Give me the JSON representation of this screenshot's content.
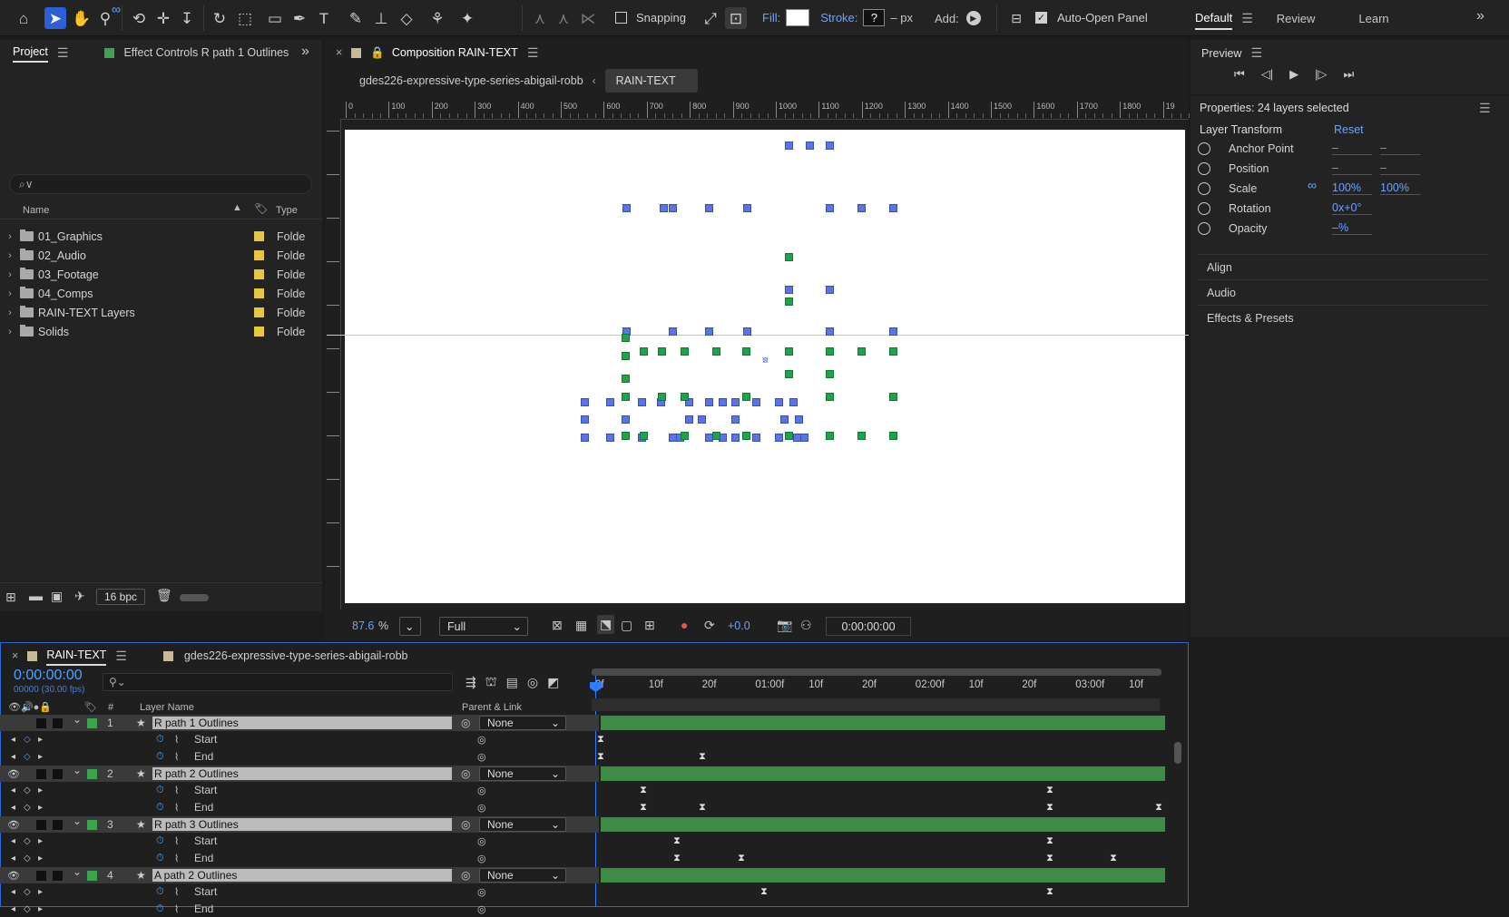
{
  "toolbar": {
    "snapping_label": "Snapping",
    "fill_label": "Fill:",
    "stroke_label": "Stroke:",
    "stroke_value": "?",
    "stroke_unit": "– px",
    "add_label": "Add:",
    "auto_open_label": "Auto-Open Panel",
    "workspaces": [
      "Default",
      "Review",
      "Learn"
    ]
  },
  "project_panel": {
    "tab_project": "Project",
    "tab_effect_controls": "Effect Controls R path 1 Outlines",
    "search_placeholder": "⌕∨",
    "col_name": "Name",
    "col_type": "Type",
    "items": [
      {
        "name": "01_Graphics",
        "type": "Folde"
      },
      {
        "name": "02_Audio",
        "type": "Folde"
      },
      {
        "name": "03_Footage",
        "type": "Folde"
      },
      {
        "name": "04_Comps",
        "type": "Folde"
      },
      {
        "name": "RAIN-TEXT Layers",
        "type": "Folde"
      },
      {
        "name": "Solids",
        "type": "Folde"
      }
    ],
    "bpc": "16 bpc"
  },
  "composition": {
    "tab_title": "Composition RAIN-TEXT",
    "breadcrumb_parent": "gdes226-expressive-type-series-abigail-robb",
    "breadcrumb_current": "RAIN-TEXT",
    "ruler_labels": [
      "0",
      "100",
      "200",
      "300",
      "400",
      "500",
      "600",
      "700",
      "800",
      "900",
      "1000",
      "1100",
      "1200",
      "1300",
      "1400",
      "1500",
      "1600",
      "1700",
      "1800",
      "19"
    ],
    "zoom": "87.6",
    "zoom_unit": "%",
    "resolution": "Full",
    "exposure": "+0.0",
    "timecode": "0:00:00:00"
  },
  "preview": {
    "title": "Preview"
  },
  "properties": {
    "title": "Properties: 24 layers selected",
    "section": "Layer Transform",
    "reset": "Reset",
    "rows": [
      {
        "label": "Anchor Point",
        "v1": "–",
        "v2": "–"
      },
      {
        "label": "Position",
        "v1": "–",
        "v2": "–"
      },
      {
        "label": "Scale",
        "v1": "100%",
        "v2": "100%"
      },
      {
        "label": "Rotation",
        "v1": "0x+0°",
        "v2": ""
      },
      {
        "label": "Opacity",
        "v1": "–%",
        "v2": ""
      }
    ],
    "sections": [
      "Align",
      "Audio",
      "Effects & Presets"
    ]
  },
  "timeline": {
    "tab_current": "RAIN-TEXT",
    "tab_other": "gdes226-expressive-type-series-abigail-robb",
    "timecode": "0:00:00:00",
    "frames": "00000 (30.00 fps)",
    "col_hash": "#",
    "col_layer_name": "Layer Name",
    "col_parent": "Parent & Link",
    "time_labels": [
      "0f",
      "10f",
      "20f",
      "01:00f",
      "10f",
      "20f",
      "02:00f",
      "10f",
      "20f",
      "03:00f",
      "10f"
    ],
    "layers": [
      {
        "num": "1",
        "name": "R path 1 Outlines",
        "parent": "None"
      },
      {
        "num": "2",
        "name": "R path 2 Outlines",
        "parent": "None"
      },
      {
        "num": "3",
        "name": "R path 3 Outlines",
        "parent": "None"
      },
      {
        "num": "4",
        "name": "A path 2 Outlines",
        "parent": "None"
      }
    ],
    "sub_start": "Start",
    "sub_end": "End"
  }
}
